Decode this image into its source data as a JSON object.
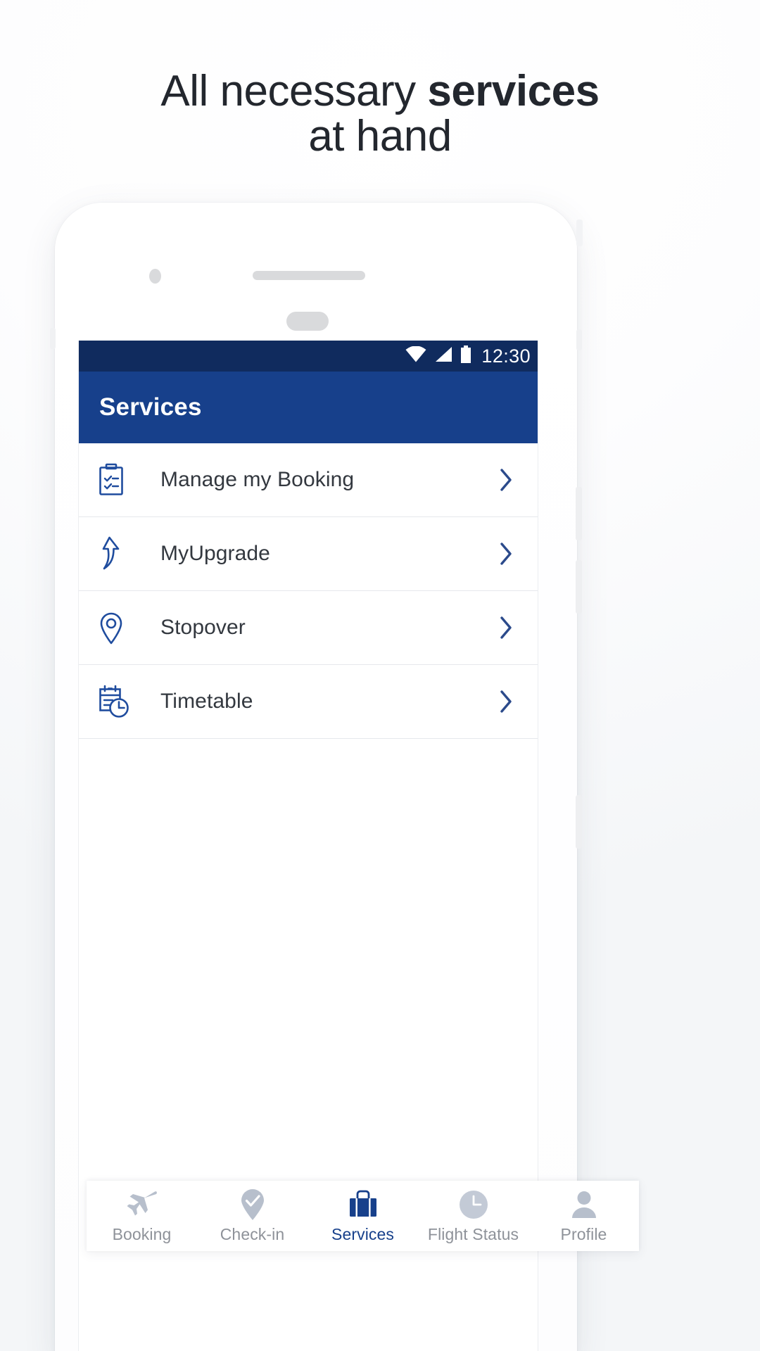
{
  "headline": {
    "line1_prefix": "All necessary ",
    "line1_bold": "services",
    "line2": "at hand"
  },
  "colors": {
    "status_bar": "#102b5e",
    "app_bar": "#17408b",
    "accent": "#17408b",
    "icon_blue": "#1f4c9e",
    "inactive_gray": "#b7bfcc",
    "label_gray": "#8e9299",
    "text_dark": "#33383f",
    "divider": "#e6e8ec",
    "page_bg": "#f4f6f8"
  },
  "phone": {
    "status_bar": {
      "icons": [
        "wifi-icon",
        "cellular-signal-icon",
        "battery-icon"
      ],
      "clock": "12:30"
    },
    "app_bar": {
      "title": "Services"
    },
    "services_list": [
      {
        "label": "Manage my Booking",
        "icon": "clipboard-checklist-icon",
        "chevron": "chevron-right-icon"
      },
      {
        "label": "MyUpgrade",
        "icon": "upward-arrow-icon",
        "chevron": "chevron-right-icon"
      },
      {
        "label": "Stopover",
        "icon": "map-pin-icon",
        "chevron": "chevron-right-icon"
      },
      {
        "label": "Timetable",
        "icon": "calendar-clock-icon",
        "chevron": "chevron-right-icon"
      }
    ],
    "bottom_nav": [
      {
        "label": "Booking",
        "icon": "airplane-icon",
        "active": false
      },
      {
        "label": "Check-in",
        "icon": "pin-check-icon",
        "active": false
      },
      {
        "label": "Services",
        "icon": "suitcase-icon",
        "active": true
      },
      {
        "label": "Flight Status",
        "icon": "clock-circle-icon",
        "active": false
      },
      {
        "label": "Profile",
        "icon": "person-avatar-icon",
        "active": false
      }
    ]
  }
}
